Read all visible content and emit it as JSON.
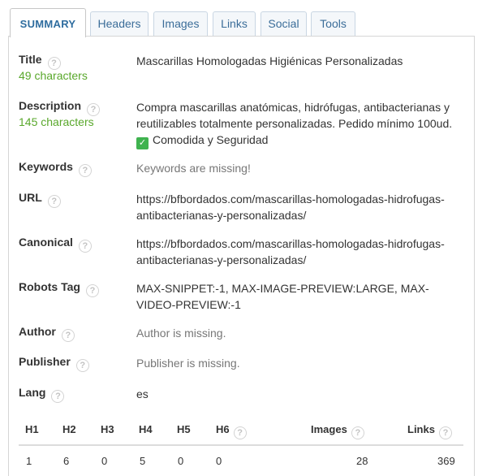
{
  "tabs": [
    {
      "label": "SUMMARY",
      "active": true
    },
    {
      "label": "Headers",
      "active": false
    },
    {
      "label": "Images",
      "active": false
    },
    {
      "label": "Links",
      "active": false
    },
    {
      "label": "Social",
      "active": false
    },
    {
      "label": "Tools",
      "active": false
    }
  ],
  "help_glyph": "?",
  "check_glyph": "✓",
  "fields": {
    "title": {
      "label": "Title",
      "count": "49 characters",
      "value": "Mascarillas Homologadas Higiénicas Personalizadas"
    },
    "description": {
      "label": "Description",
      "count": "145 characters",
      "value": "Compra mascarillas anatómicas, hidrófugas, antibacterianas y reutilizables totalmente personalizadas. Pedido mínimo 100ud.",
      "value_extra": "Comodida y Seguridad"
    },
    "keywords": {
      "label": "Keywords",
      "value": "Keywords are missing!"
    },
    "url": {
      "label": "URL",
      "value": "https://bfbordados.com/mascarillas-homologadas-hidrofugas-antibacterianas-y-personalizadas/"
    },
    "canonical": {
      "label": "Canonical",
      "value": "https://bfbordados.com/mascarillas-homologadas-hidrofugas-antibacterianas-y-personalizadas/"
    },
    "robots": {
      "label": "Robots Tag",
      "value": "MAX-SNIPPET:-1, MAX-IMAGE-PREVIEW:LARGE, MAX-VIDEO-PREVIEW:-1"
    },
    "author": {
      "label": "Author",
      "value": "Author is missing."
    },
    "publisher": {
      "label": "Publisher",
      "value": "Publisher is missing."
    },
    "lang": {
      "label": "Lang",
      "value": "es"
    }
  },
  "stats": {
    "headers": [
      "H1",
      "H2",
      "H3",
      "H4",
      "H5",
      "H6"
    ],
    "header_values": [
      "1",
      "6",
      "0",
      "5",
      "0",
      "0"
    ],
    "images_label": "Images",
    "images_value": "28",
    "links_label": "Links",
    "links_value": "369"
  },
  "colors": {
    "tab_text": "#3b6d99",
    "count_green": "#5aa82c",
    "check_green": "#3fb34f"
  }
}
